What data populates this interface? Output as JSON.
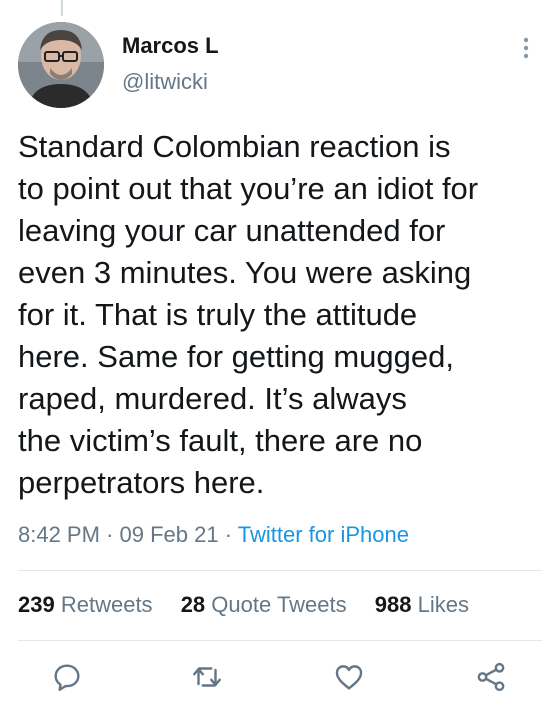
{
  "tweet": {
    "author": {
      "display_name": "Marcos L",
      "handle": "@litwicki"
    },
    "text": "Standard Colombian reaction is\nto point out that you’re an idiot for\nleaving your car unattended for\neven 3 minutes. You were asking\nfor it. That is truly the attitude\nhere. Same for getting mugged,\nraped, murdered. It’s always\nthe victim’s fault, there are no\nperpetrators here.",
    "time": "8:42 PM",
    "date": "09 Feb 21",
    "separator": "·",
    "source": "Twitter for iPhone"
  },
  "stats": {
    "retweets": {
      "count": "239",
      "label": "Retweets"
    },
    "quotes": {
      "count": "28",
      "label": "Quote Tweets"
    },
    "likes": {
      "count": "988",
      "label": "Likes"
    }
  },
  "icons": {
    "more": "more-vertical-icon",
    "reply": "reply-icon",
    "retweet": "retweet-icon",
    "like": "heart-icon",
    "share": "share-icon"
  },
  "colors": {
    "link": "#1b95e0",
    "secondary_text": "#657786",
    "primary_text": "#14171a",
    "divider": "#e1e8ed"
  }
}
